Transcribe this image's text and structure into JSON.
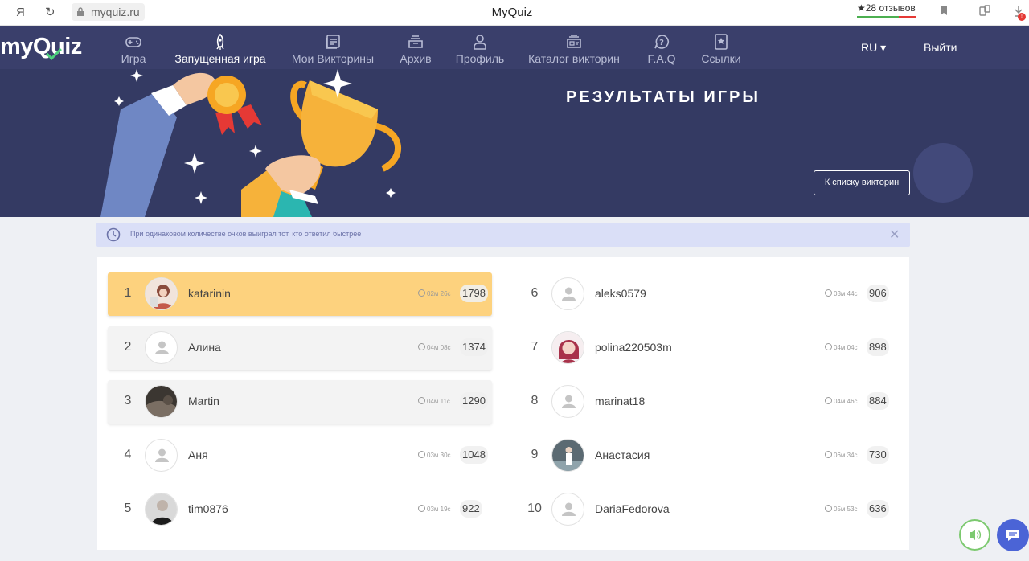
{
  "browser": {
    "ya": "Я",
    "url": "myquiz.ru",
    "title": "MyQuiz",
    "reviews": "★28 отзывов"
  },
  "nav": {
    "logo_pre": "my",
    "logo_q": "Q",
    "logo_post": "uiz",
    "items": [
      {
        "label": "Игра",
        "icon": "gamepad-icon"
      },
      {
        "label": "Запущенная игра",
        "icon": "rocket-icon"
      },
      {
        "label": "Мои Викторины",
        "icon": "quizzes-icon"
      },
      {
        "label": "Архив",
        "icon": "archive-icon"
      },
      {
        "label": "Профиль",
        "icon": "profile-icon"
      },
      {
        "label": "Каталог викторин",
        "icon": "catalog-icon"
      },
      {
        "label": "F.A.Q",
        "icon": "faq-icon"
      },
      {
        "label": "Ссылки",
        "icon": "links-icon"
      }
    ],
    "lang": "RU ▾",
    "logout": "Выйти"
  },
  "hero": {
    "title": "РЕЗУЛЬТАТЫ ИГРЫ",
    "back_button": "К списку викторин"
  },
  "info": {
    "text": "При одинаковом количестве очков выиграл тот, кто ответил быстрее"
  },
  "results": [
    {
      "rank": "1",
      "name": "katarinin",
      "time": "02м 26с",
      "score": "1798"
    },
    {
      "rank": "2",
      "name": "Алина",
      "time": "04м 08с",
      "score": "1374"
    },
    {
      "rank": "3",
      "name": "Martin",
      "time": "04м 11с",
      "score": "1290"
    },
    {
      "rank": "4",
      "name": "Аня",
      "time": "03м 30с",
      "score": "1048"
    },
    {
      "rank": "5",
      "name": "tim0876",
      "time": "03м 19с",
      "score": "922"
    },
    {
      "rank": "6",
      "name": "aleks0579",
      "time": "03м 44с",
      "score": "906"
    },
    {
      "rank": "7",
      "name": "polina220503m",
      "time": "04м 04с",
      "score": "898"
    },
    {
      "rank": "8",
      "name": "marinat18",
      "time": "04м 46с",
      "score": "884"
    },
    {
      "rank": "9",
      "name": "Анастасия",
      "time": "06м 34с",
      "score": "730"
    },
    {
      "rank": "10",
      "name": "DariaFedorova",
      "time": "05м 53с",
      "score": "636"
    }
  ],
  "colors": {
    "nav_bg": "#3a3f6b",
    "hero_bg": "#343a63",
    "gold_row": "#fdd27e",
    "info_bg": "#dadff7",
    "chat_fab": "#4b64d6"
  }
}
